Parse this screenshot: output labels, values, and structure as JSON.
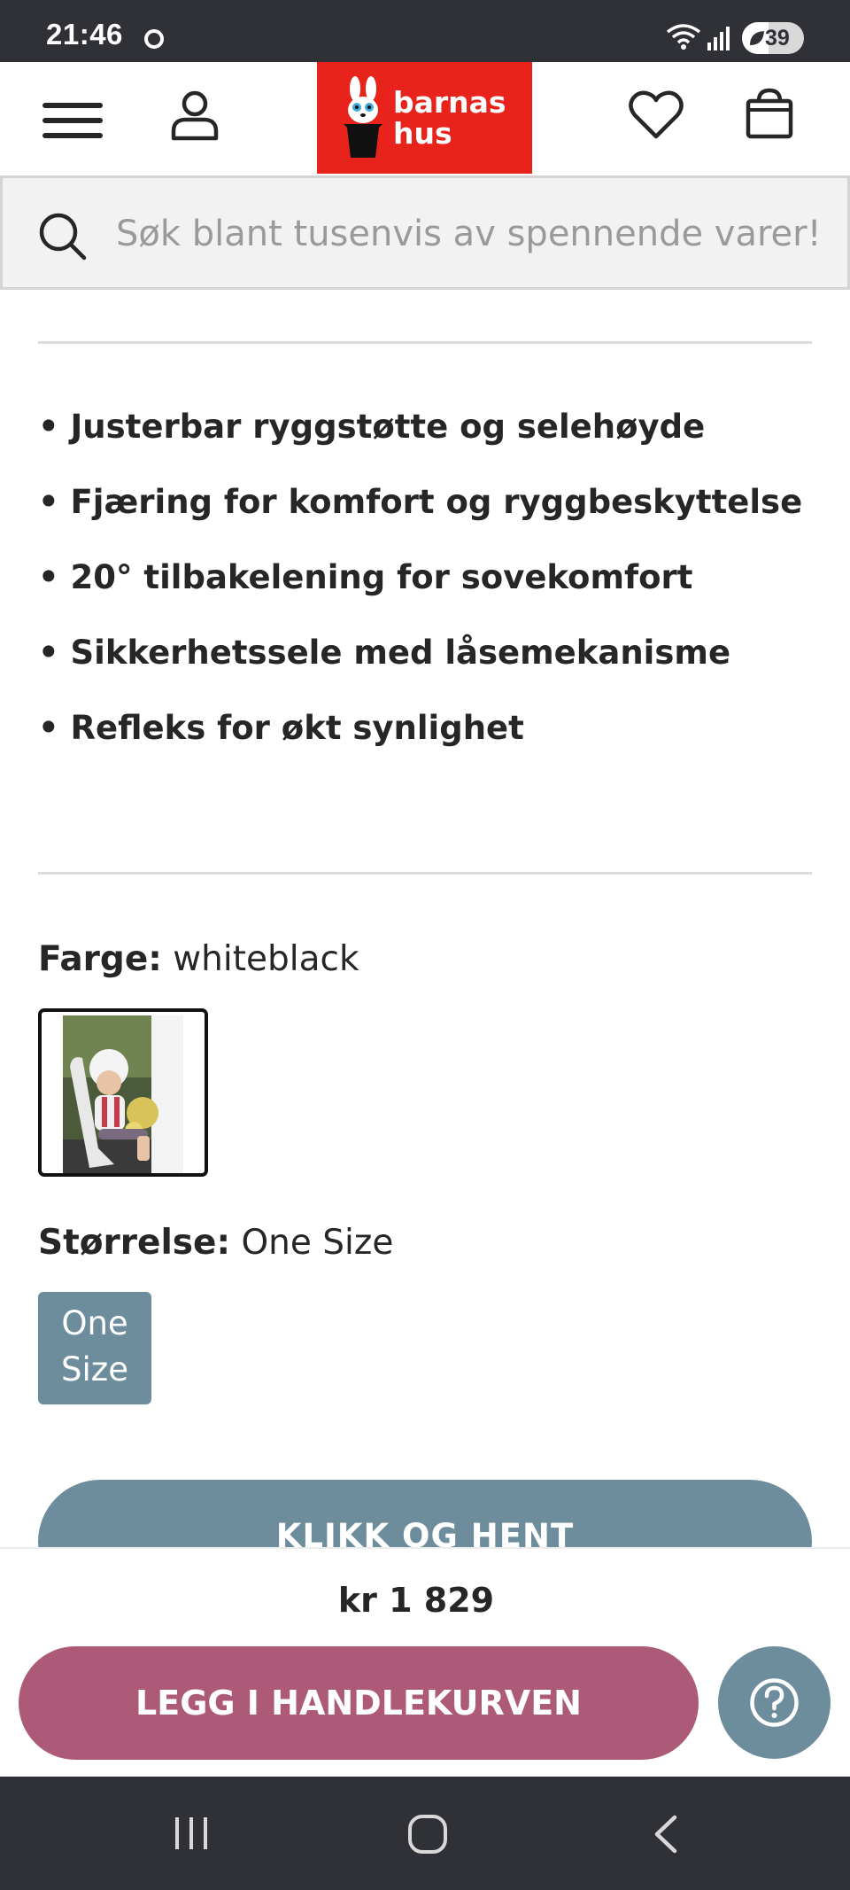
{
  "status_bar": {
    "time": "21:46",
    "battery": "39"
  },
  "header": {
    "logo_line1": "barnas",
    "logo_line2": "hus"
  },
  "search": {
    "placeholder": "Søk blant tusenvis av spennende varer!"
  },
  "features": [
    "• Justerbar ryggstøtte og selehøyde",
    "• Fjæring for komfort og ryggbeskyttelse",
    "• 20° tilbakelening for sovekomfort",
    "• Sikkerhetssele med låsemekanisme",
    "• Refleks for økt synlighet"
  ],
  "color": {
    "label": "Farge:",
    "value": "whiteblack"
  },
  "size": {
    "label": "Størrelse:",
    "value": "One Size",
    "option_line1": "One",
    "option_line2": "Size"
  },
  "pickup_button": "KLIKK OG HENT",
  "price": "kr 1 829",
  "add_to_cart": "LEGG I HANDLEKURVEN",
  "colors": {
    "brand_red": "#e8231b",
    "accent_blue": "#6d8d9c",
    "cart_pink": "#ad5a78",
    "system_bar": "#303136"
  }
}
